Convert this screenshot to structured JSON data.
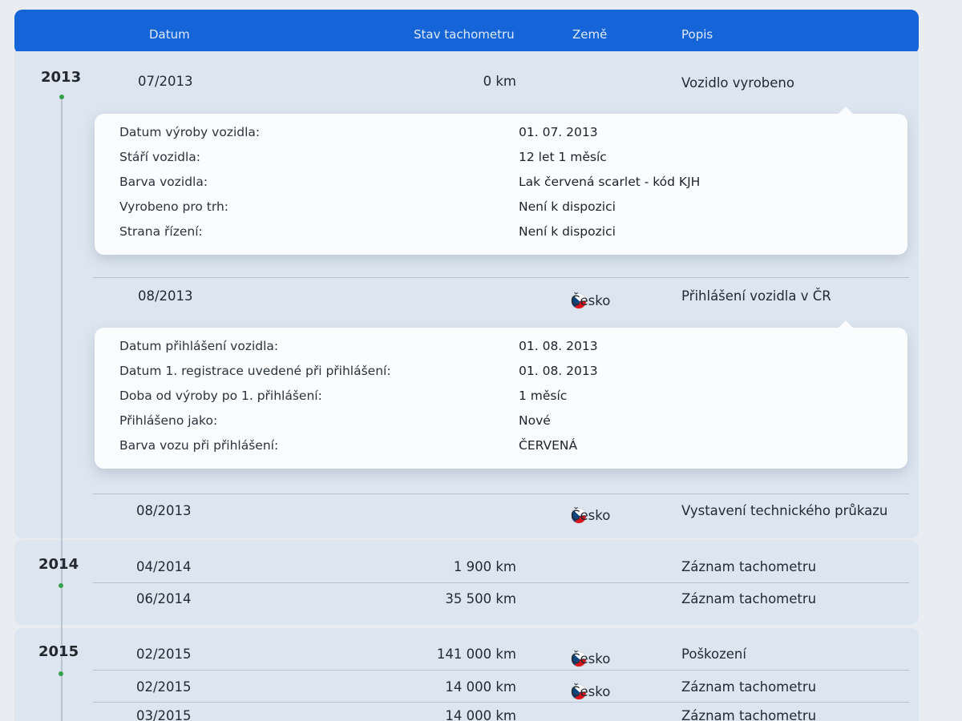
{
  "header": {
    "col_date": "Datum",
    "col_odometer": "Stav tachometru",
    "col_country": "Země",
    "col_desc": "Popis"
  },
  "years": {
    "y2013": "2013",
    "y2014": "2014",
    "y2015": "2015"
  },
  "rows": [
    {
      "date": "07/2013",
      "km": "0 km",
      "country": "",
      "desc": "Vozidlo vyrobeno"
    },
    {
      "date": "08/2013",
      "km": "",
      "country": "Česko",
      "desc": "Přihlášení vozidla v ČR"
    },
    {
      "date": "08/2013",
      "km": "",
      "country": "Česko",
      "desc": "Vystavení technického průkazu"
    },
    {
      "date": "04/2014",
      "km": "1 900 km",
      "country": "",
      "desc": "Záznam tachometru"
    },
    {
      "date": "06/2014",
      "km": "35 500 km",
      "country": "",
      "desc": "Záznam tachometru"
    },
    {
      "date": "02/2015",
      "km": "141 000 km",
      "country": "Česko",
      "desc": "Poškození"
    },
    {
      "date": "02/2015",
      "km": "14 000 km",
      "country": "Česko",
      "desc": "Záznam tachometru"
    },
    {
      "date": "03/2015",
      "km": "14 000 km",
      "country": "",
      "desc": "Záznam tachometru"
    }
  ],
  "production_details": [
    {
      "key": "Datum výroby vozidla:",
      "value": "01. 07. 2013"
    },
    {
      "key": "Stáří vozidla:",
      "value": "12 let 1 měsíc"
    },
    {
      "key": "Barva vozidla:",
      "value": "Lak červená scarlet - kód KJH"
    },
    {
      "key": "Vyrobeno pro trh:",
      "value": "Není k dispozici"
    },
    {
      "key": "Strana řízení:",
      "value": "Není k dispozici"
    }
  ],
  "registration_details": [
    {
      "key": "Datum přihlášení vozidla:",
      "value": "01. 08. 2013"
    },
    {
      "key": "Datum 1. registrace uvedené při přihlášení:",
      "value": "01. 08. 2013"
    },
    {
      "key": "Doba od výroby po 1. přihlášení:",
      "value": "1 měsíc"
    },
    {
      "key": "Přihlášeno jako:",
      "value": "Nové"
    },
    {
      "key": "Barva vozu při přihlášení:",
      "value": "ČERVENÁ"
    }
  ],
  "colors": {
    "header_bg": "#1565d8",
    "year_block_bg": "#dde6f0",
    "timeline_dot": "#37a04a"
  },
  "icons": {
    "country_flag": "czech-flag-icon"
  }
}
